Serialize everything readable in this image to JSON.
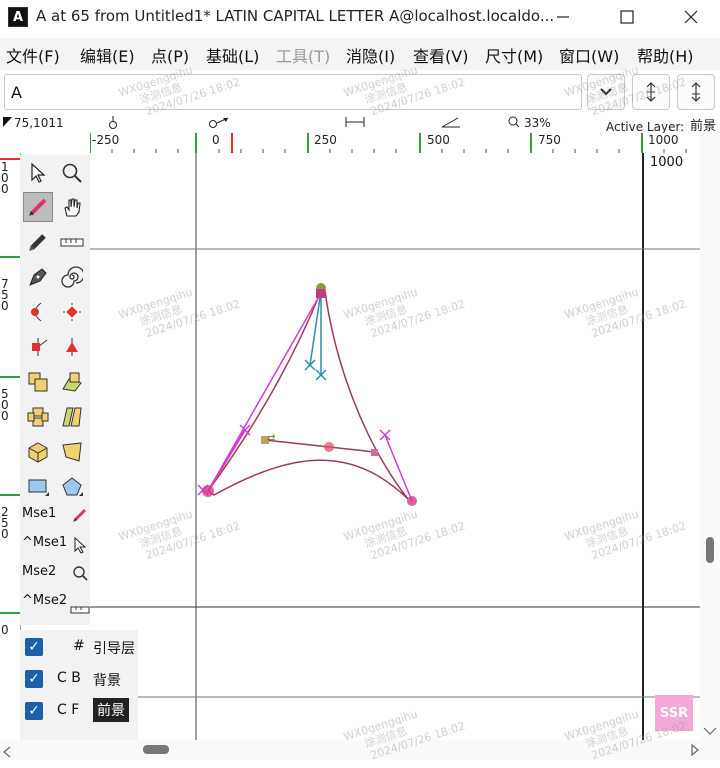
{
  "window": {
    "icon_letter": "A",
    "title": "A at 65 from Untitled1* LATIN CAPITAL LETTER A@localhost.localdo...",
    "minimize_icon": "minimize-icon",
    "maximize_icon": "maximize-icon",
    "close_icon": "close-icon"
  },
  "menu": [
    {
      "label": "文件(F)",
      "enabled": true
    },
    {
      "label": "编辑(E)",
      "enabled": true
    },
    {
      "label": "点(P)",
      "enabled": true
    },
    {
      "label": "基础(L)",
      "enabled": true
    },
    {
      "label": "工具(T)",
      "enabled": false
    },
    {
      "label": "消隐(I)",
      "enabled": true
    },
    {
      "label": "查看(V)",
      "enabled": true
    },
    {
      "label": "尺寸(M)",
      "enabled": true
    },
    {
      "label": "窗口(W)",
      "enabled": true
    },
    {
      "label": "帮助(H)",
      "enabled": true
    }
  ],
  "glyph_field": {
    "value": "A"
  },
  "status": {
    "coords": "75,1011",
    "zoom": "33%",
    "active_layer_label": "Active Layer:",
    "active_layer_value": "前景"
  },
  "ruler": {
    "h_labels": [
      "-250",
      "0",
      "250",
      "500",
      "750",
      "1000"
    ],
    "v_labels": [
      "100",
      "750",
      "500",
      "250",
      "0"
    ],
    "canvas_label": "1000"
  },
  "toolbox": {
    "tools": [
      "pointer-icon",
      "magnify-icon",
      "pencil-icon",
      "hand-icon",
      "feltpen-icon",
      "ruler-icon",
      "pen-icon",
      "spiral-icon",
      "curve-point-icon",
      "corner-point-icon",
      "tangent-point-icon",
      "hvcurve-point-icon",
      "scale-icon",
      "rotate-icon",
      "flip-icon",
      "skew-icon",
      "3d-rotate-icon",
      "perspective-icon",
      "rectangle-icon",
      "polygon-icon"
    ],
    "mouse_labels": [
      "Mse1",
      "^Mse1",
      "Mse2",
      "^Mse2"
    ]
  },
  "layers": [
    {
      "checked": true,
      "flag": "#",
      "name": "引导层"
    },
    {
      "checked": true,
      "flag": "C B",
      "name": "背景"
    },
    {
      "checked": true,
      "flag": "C F",
      "name": "前景"
    }
  ],
  "watermark": {
    "line1": "WX0gengqihu",
    "line2": "涂测信息",
    "line3": "2024/07/26 18:02"
  },
  "badge": "SSR",
  "colors": {
    "outline": "#9b3a5a",
    "handle_magenta": "#d63ad6",
    "handle_cyan": "#2a8fa8",
    "point_red": "#e0506a"
  }
}
